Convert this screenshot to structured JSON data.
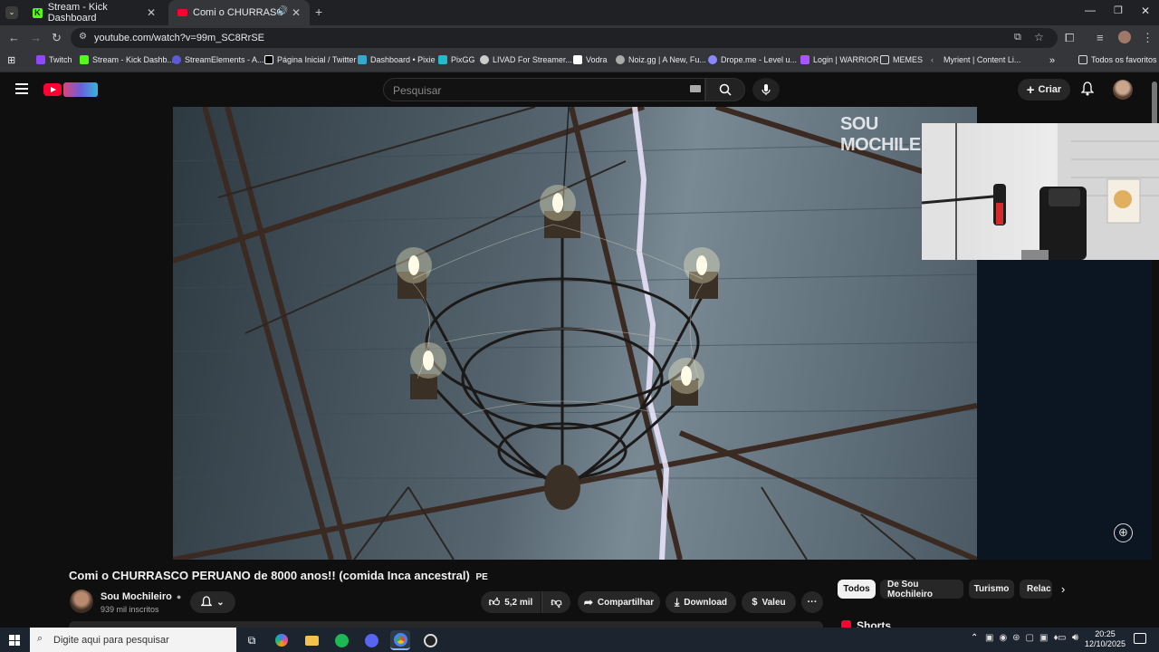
{
  "browser": {
    "tabs": [
      {
        "title": "Stream - Kick Dashboard"
      },
      {
        "title": "Comi o CHURRASCO PERU"
      }
    ],
    "url": "youtube.com/watch?v=99m_SC8RrSE"
  },
  "bookmarks": [
    {
      "label": "Twitch",
      "color": "#9146ff"
    },
    {
      "label": "Stream - Kick Dashb...",
      "color": "#53fc18"
    },
    {
      "label": "StreamElements - A...",
      "color": "#5b5bd6"
    },
    {
      "label": "Página Inicial / Twitter",
      "color": "#ffffff"
    },
    {
      "label": "Dashboard • Pixie",
      "color": "#3ac"
    },
    {
      "label": "PixGG",
      "color": "#2bc"
    },
    {
      "label": "LIVAD For Streamer...",
      "color": "#ccc"
    },
    {
      "label": "Vodra",
      "color": "#fff"
    },
    {
      "label": "Noiz.gg | A New, Fu...",
      "color": "#aaa"
    },
    {
      "label": "Drope.me - Level u...",
      "color": "#88f"
    },
    {
      "label": "Login | WARRIOR",
      "color": "#a5f"
    },
    {
      "label": "MEMES",
      "color": "#ddd"
    },
    {
      "label": "Myrient | Content Li...",
      "color": "#aaa"
    }
  ],
  "bookmarks_all": "Todos os favoritos",
  "youtube": {
    "search_placeholder": "Pesquisar",
    "create_label": "Criar",
    "video_watermark": "SOU MOCHILEIRO",
    "video_title": "Comi o CHURRASCO PERUANO de 8000 anos!! (comida Inca ancestral)",
    "video_title_tag": "PE",
    "channel_name": "Sou Mochileiro",
    "channel_subs": "939 mil inscritos",
    "likes": "5,2 mil",
    "share_label": "Compartilhar",
    "download_label": "Download",
    "thanks_label": "Valeu",
    "chips": [
      "Todos",
      "De Sou Mochileiro",
      "Turismo",
      "Relac"
    ],
    "shorts_label": "Shorts"
  },
  "taskbar": {
    "search_placeholder": "Digite aqui para pesquisar",
    "time": "20:25",
    "date": "12/10/2025"
  }
}
